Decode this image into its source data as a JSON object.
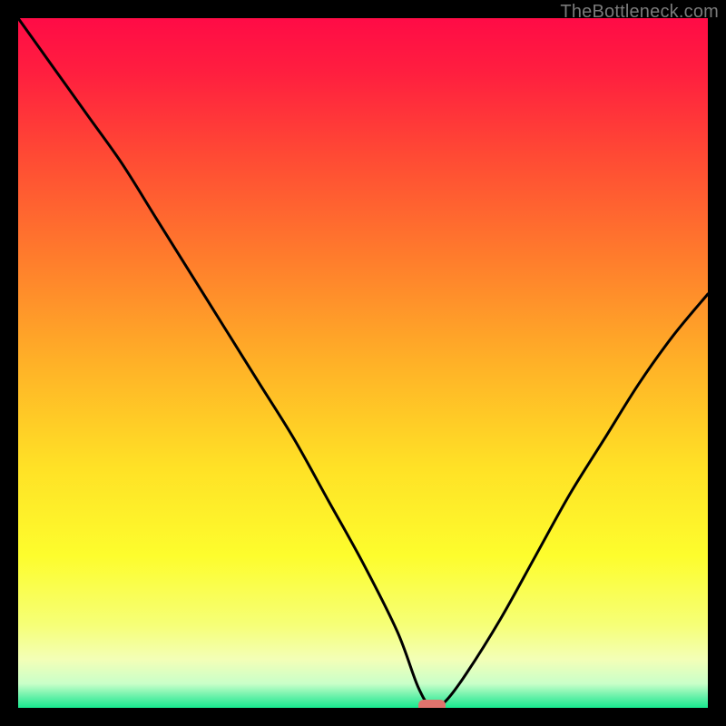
{
  "watermark": "TheBottleneck.com",
  "chart_data": {
    "type": "line",
    "title": "",
    "xlabel": "",
    "ylabel": "",
    "xlim": [
      0,
      100
    ],
    "ylim": [
      0,
      100
    ],
    "grid": false,
    "legend": null,
    "series": [
      {
        "name": "bottleneck-curve",
        "x": [
          0,
          5,
          10,
          15,
          20,
          25,
          30,
          35,
          40,
          45,
          50,
          55,
          58,
          60,
          62,
          65,
          70,
          75,
          80,
          85,
          90,
          95,
          100
        ],
        "values": [
          100,
          93,
          86,
          79,
          71,
          63,
          55,
          47,
          39,
          30,
          21,
          11,
          3,
          0,
          1,
          5,
          13,
          22,
          31,
          39,
          47,
          54,
          60
        ]
      }
    ],
    "annotations": [
      {
        "name": "min-marker",
        "x": 60,
        "y": 0
      }
    ],
    "background_gradient": {
      "stops": [
        {
          "offset": 0.0,
          "color": "#ff0b46"
        },
        {
          "offset": 0.08,
          "color": "#ff1f3f"
        },
        {
          "offset": 0.2,
          "color": "#ff4a34"
        },
        {
          "offset": 0.35,
          "color": "#ff7d2c"
        },
        {
          "offset": 0.5,
          "color": "#ffb127"
        },
        {
          "offset": 0.65,
          "color": "#ffe126"
        },
        {
          "offset": 0.78,
          "color": "#fdfd2d"
        },
        {
          "offset": 0.88,
          "color": "#f6ff77"
        },
        {
          "offset": 0.93,
          "color": "#f3ffb7"
        },
        {
          "offset": 0.965,
          "color": "#c9ffc9"
        },
        {
          "offset": 0.985,
          "color": "#60f0a7"
        },
        {
          "offset": 1.0,
          "color": "#17e98e"
        }
      ]
    },
    "marker_color": "#e0736d",
    "curve_color": "#000000"
  }
}
